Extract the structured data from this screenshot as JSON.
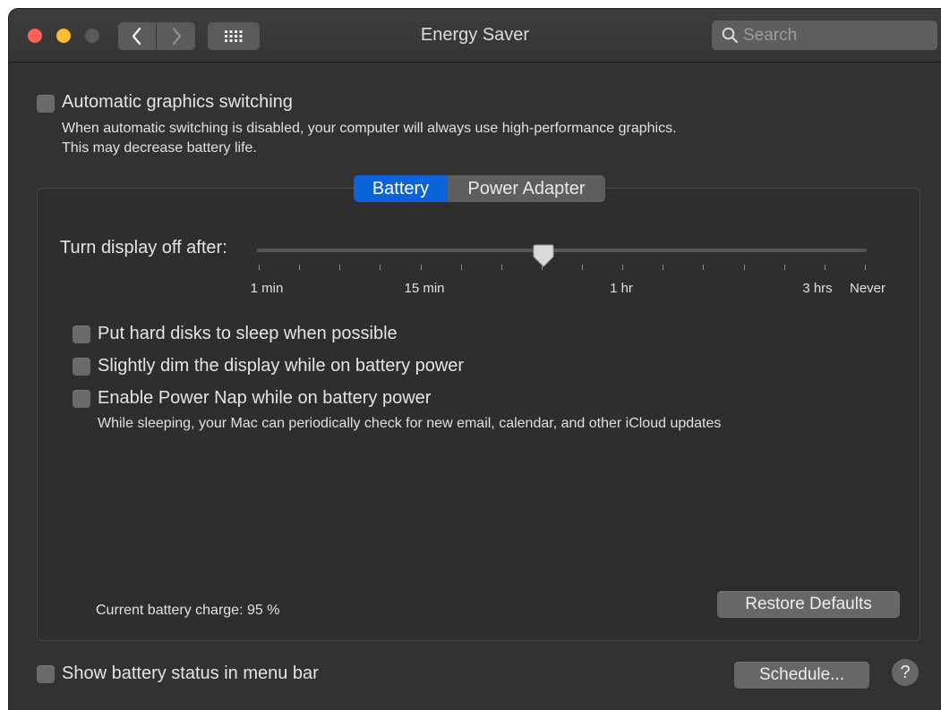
{
  "window": {
    "title": "Energy Saver",
    "search_placeholder": "Search"
  },
  "graphics": {
    "label": "Automatic graphics switching",
    "checked": false,
    "description_line1": "When automatic switching is disabled, your computer will always use high-performance graphics.",
    "description_line2": "This may decrease battery life."
  },
  "tabs": [
    {
      "label": "Battery",
      "selected": true
    },
    {
      "label": "Power Adapter",
      "selected": false
    }
  ],
  "display_sleep": {
    "label": "Turn display off after:",
    "tick_labels": [
      "1 min",
      "15 min",
      "1 hr",
      "3 hrs",
      "Never"
    ],
    "value_fraction": 0.47
  },
  "options": [
    {
      "label": "Put hard disks to sleep when possible",
      "checked": false
    },
    {
      "label": "Slightly dim the display while on battery power",
      "checked": false
    },
    {
      "label": "Enable Power Nap while on battery power",
      "checked": false
    }
  ],
  "power_nap_description": "While sleeping, your Mac can periodically check for new email, calendar, and other iCloud updates",
  "battery_charge": "Current battery charge: 95 %",
  "restore_defaults_label": "Restore Defaults",
  "show_status": {
    "label": "Show battery status in menu bar",
    "checked": false
  },
  "schedule_label": "Schedule...",
  "help_label": "?",
  "colors": {
    "accent": "#0a63d8",
    "close": "#fe5f57",
    "minimize": "#febc2e",
    "window_background": "#323232"
  }
}
